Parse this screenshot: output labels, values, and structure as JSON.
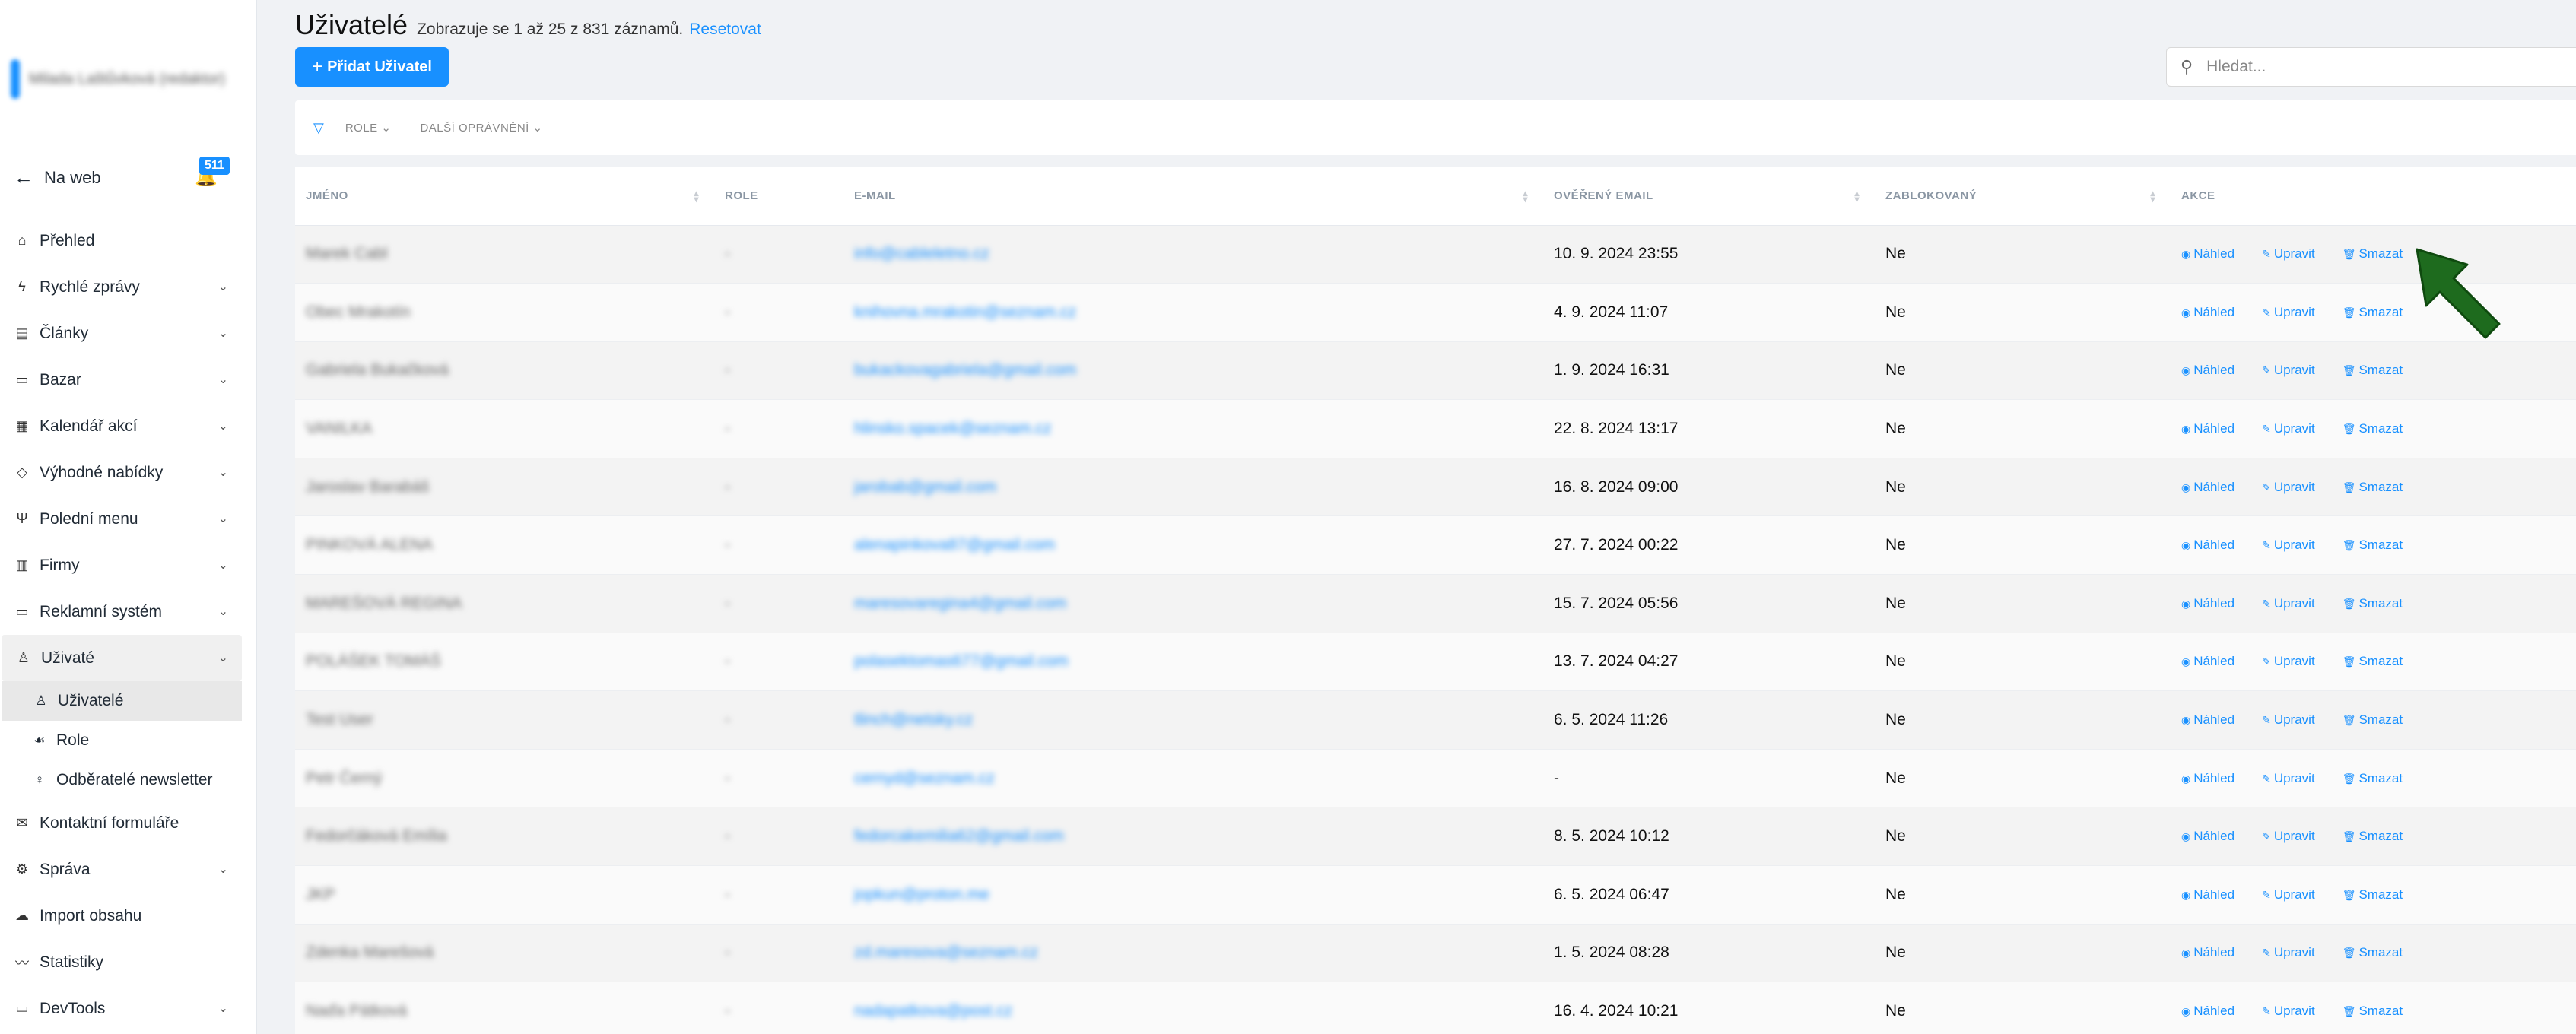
{
  "sidebar": {
    "user_name": "Milada Laštůvková (redaktor)",
    "back_to_web": "Na web",
    "notification_count": "511",
    "menu": [
      {
        "label": "Přehled",
        "icon": "home-icon"
      },
      {
        "label": "Rychlé zprávy",
        "icon": "bolt-icon"
      },
      {
        "label": "Články",
        "icon": "articles-icon"
      },
      {
        "label": "Bazar",
        "icon": "bazar-icon"
      },
      {
        "label": "Kalendář akcí",
        "icon": "calendar-icon"
      },
      {
        "label": "Výhodné nabídky",
        "icon": "tag-icon"
      },
      {
        "label": "Polední menu",
        "icon": "cutlery-icon"
      },
      {
        "label": "Firmy",
        "icon": "building-icon"
      },
      {
        "label": "Reklamní systém",
        "icon": "ads-icon"
      },
      {
        "label": "Uživaté",
        "icon": "user-icon"
      }
    ],
    "submenu": [
      {
        "label": "Uživatelé",
        "icon": "user-icon"
      },
      {
        "label": "Role",
        "icon": "role-icon"
      },
      {
        "label": "Odběratelé newsletter",
        "icon": "newsletter-icon"
      }
    ],
    "menu2": [
      {
        "label": "Kontaktní formuláře",
        "icon": "mail-icon"
      },
      {
        "label": "Správa",
        "icon": "settings-icon"
      },
      {
        "label": "Import obsahu",
        "icon": "import-icon"
      },
      {
        "label": "Statistiky",
        "icon": "stats-icon"
      },
      {
        "label": "DevTools",
        "icon": "devtools-icon"
      }
    ]
  },
  "header": {
    "title": "Uživatelé",
    "info": "Zobrazuje se 1 až 25 z 831 záznamů.",
    "reset": "Resetovat",
    "add_button": "Přidat Uživatel",
    "search_placeholder": "Hledat..."
  },
  "filters": [
    "ROLE",
    "DALŠÍ OPRÁVNĚNÍ"
  ],
  "table": {
    "columns": [
      "JMÉNO",
      "ROLE",
      "E-MAIL",
      "OVĚŘENÝ EMAIL",
      "ZABLOKOVANÝ",
      "AKCE"
    ],
    "actions": {
      "view": "Náhled",
      "edit": "Upravit",
      "delete": "Smazat"
    },
    "rows": [
      {
        "name": "Marek Cabl",
        "role": "-",
        "email": "info@cableletno.cz",
        "verified": "10. 9. 2024 23:55",
        "blocked": "Ne"
      },
      {
        "name": "Obec Mrakotín",
        "role": "-",
        "email": "knihovna.mrakotin@seznam.cz",
        "verified": "4. 9. 2024 11:07",
        "blocked": "Ne"
      },
      {
        "name": "Gabriela Bukačková",
        "role": "-",
        "email": "bukackovagabriela@gmail.com",
        "verified": "1. 9. 2024 16:31",
        "blocked": "Ne"
      },
      {
        "name": "VANILKA",
        "role": "-",
        "email": "hlinsko.spacek@seznam.cz",
        "verified": "22. 8. 2024 13:17",
        "blocked": "Ne"
      },
      {
        "name": "Jaroslav Barabáš",
        "role": "-",
        "email": "jarobab@gmail.com",
        "verified": "16. 8. 2024 09:00",
        "blocked": "Ne"
      },
      {
        "name": "PINKOVÁ ALENA",
        "role": "-",
        "email": "alenapinkova87@gmail.com",
        "verified": "27. 7. 2024 00:22",
        "blocked": "Ne"
      },
      {
        "name": "MAREŠOVÁ REGINA",
        "role": "-",
        "email": "maresovaregina4@gmail.com",
        "verified": "15. 7. 2024 05:56",
        "blocked": "Ne"
      },
      {
        "name": "POLÁŠEK TOMÁŠ",
        "role": "-",
        "email": "polasektomas677@gmail.com",
        "verified": "13. 7. 2024 04:27",
        "blocked": "Ne"
      },
      {
        "name": "Test User",
        "role": "-",
        "email": "tlinch@netsky.cz",
        "verified": "6. 5. 2024 11:26",
        "blocked": "Ne"
      },
      {
        "name": "Petr Černý",
        "role": "-",
        "email": "cernyd@seznam.cz",
        "verified": "-",
        "blocked": "Ne"
      },
      {
        "name": "Fedorčáková Emília",
        "role": "-",
        "email": "fedorcakemilia62@gmail.com",
        "verified": "8. 5. 2024 10:12",
        "blocked": "Ne"
      },
      {
        "name": "JKP",
        "role": "-",
        "email": "jopkun@proton.me",
        "verified": "6. 5. 2024 06:47",
        "blocked": "Ne"
      },
      {
        "name": "Zdenka Marešová",
        "role": "-",
        "email": "zd.maresova@seznam.cz",
        "verified": "1. 5. 2024 08:28",
        "blocked": "Ne"
      },
      {
        "name": "Naďa Pátková",
        "role": "-",
        "email": "nadapatkova@post.cz",
        "verified": "16. 4. 2024 10:21",
        "blocked": "Ne"
      }
    ]
  },
  "colors": {
    "accent": "#1890ff",
    "annotation_arrow": "#1e6b1e"
  }
}
